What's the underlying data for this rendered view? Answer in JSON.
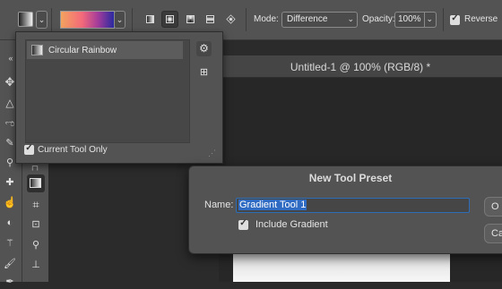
{
  "options_bar": {
    "gradient_type_icons": [
      "linear-gradient-icon",
      "radial-gradient-icon",
      "angle-gradient-icon",
      "reflected-gradient-icon",
      "diamond-gradient-icon"
    ],
    "mode_label": "Mode:",
    "mode_value": "Difference",
    "opacity_label": "Opacity:",
    "opacity_value": "100%",
    "reverse_label": "Reverse",
    "reverse_checked": true
  },
  "preset_picker": {
    "items": [
      {
        "label": "Circular Rainbow"
      }
    ],
    "current_tool_only_label": "Current Tool Only",
    "current_tool_only_checked": true
  },
  "document": {
    "title": "Untitled-1 @ 100% (RGB/8) *"
  },
  "dialog": {
    "title": "New Tool Preset",
    "name_label": "Name:",
    "name_value": "Gradient Tool 1",
    "include_gradient_label": "Include Gradient",
    "include_gradient_checked": true,
    "ok_label": "O",
    "cancel_label": "Ca"
  }
}
